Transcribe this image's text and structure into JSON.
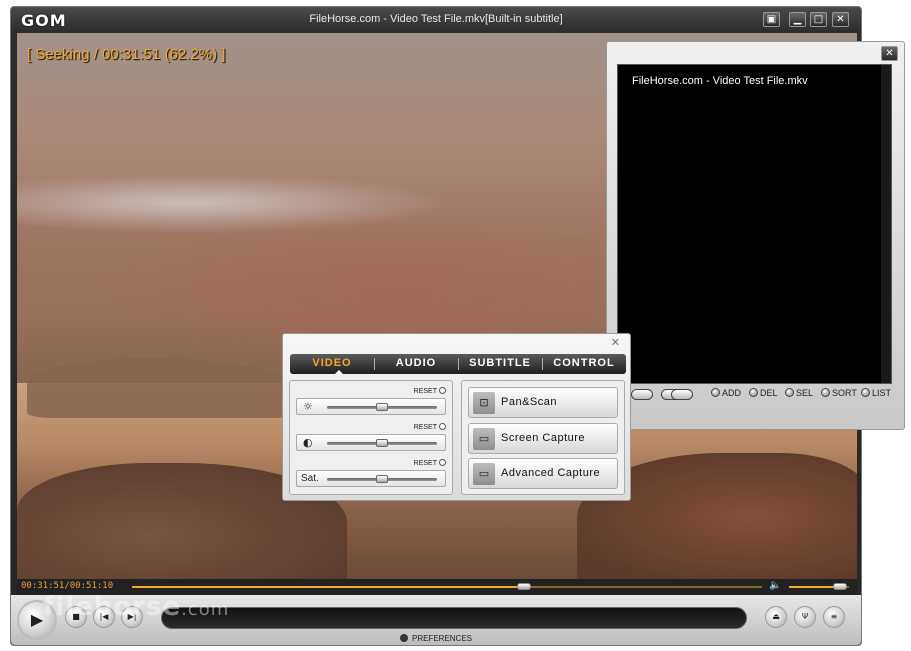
{
  "player": {
    "logo": "GOM",
    "title": "FileHorse.com - Video Test File.mkv[Built-in subtitle]",
    "osd": "[ Seeking / 00:31:51 (62.2%) ]",
    "timecode": "00:31:51/00:51:10",
    "seek_fraction": 0.622,
    "volume_fraction": 0.85,
    "preferences_label": "PREFERENCES",
    "watermark_main": "filehorse",
    "watermark_suffix": ".com",
    "titlebar_icons": [
      "screen-icon",
      "minimize-icon",
      "maximize-icon",
      "close-icon"
    ],
    "controls": [
      "play-icon",
      "stop-icon",
      "previous-icon",
      "next-icon"
    ],
    "right_controls": [
      "eject-icon",
      "equalizer-icon",
      "playlist-icon"
    ]
  },
  "playlist": {
    "items": [
      "FileHorse.com - Video Test File.mkv"
    ],
    "actions": [
      "ADD",
      "DEL",
      "SEL",
      "SORT",
      "LIST"
    ]
  },
  "panel": {
    "tabs": [
      "VIDEO",
      "AUDIO",
      "SUBTITLE",
      "CONTROL"
    ],
    "active_tab": "VIDEO",
    "reset_label": "RESET",
    "adjustments": [
      {
        "icon": "brightness-icon",
        "label": "",
        "value": 0.5
      },
      {
        "icon": "contrast-icon",
        "label": "",
        "value": 0.5
      },
      {
        "icon": "",
        "label": "Sat.",
        "value": 0.5
      }
    ],
    "capture_buttons": [
      "Pan&Scan",
      "Screen Capture",
      "Advanced Capture"
    ]
  },
  "colors": {
    "accent": "#f7a62a",
    "osd": "#f2a82c"
  }
}
